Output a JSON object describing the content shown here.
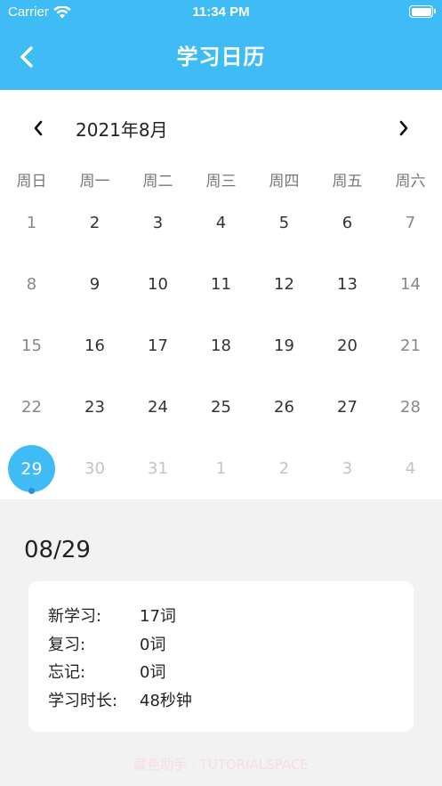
{
  "status_bar": {
    "carrier": "Carrier",
    "time": "11:34 PM"
  },
  "header": {
    "title": "学习日历"
  },
  "calendar": {
    "month_label": "2021年8月",
    "weekdays": [
      "周日",
      "周一",
      "周二",
      "周三",
      "周四",
      "周五",
      "周六"
    ],
    "weeks": [
      [
        "1",
        "2",
        "3",
        "4",
        "5",
        "6",
        "7"
      ],
      [
        "8",
        "9",
        "10",
        "11",
        "12",
        "13",
        "14"
      ],
      [
        "15",
        "16",
        "17",
        "18",
        "19",
        "20",
        "21"
      ],
      [
        "22",
        "23",
        "24",
        "25",
        "26",
        "27",
        "28"
      ],
      [
        "29",
        "30",
        "31",
        "1",
        "2",
        "3",
        "4"
      ]
    ],
    "selected_day": "29"
  },
  "detail": {
    "date": "08/29",
    "stats": [
      {
        "label": "新学习:",
        "value": "17词"
      },
      {
        "label": "复习:",
        "value": "0词"
      },
      {
        "label": "忘记:",
        "value": "0词"
      },
      {
        "label": "学习时长:",
        "value": "48秒钟"
      }
    ]
  },
  "watermark": "藏色助手 · TUTORIALSPACE"
}
